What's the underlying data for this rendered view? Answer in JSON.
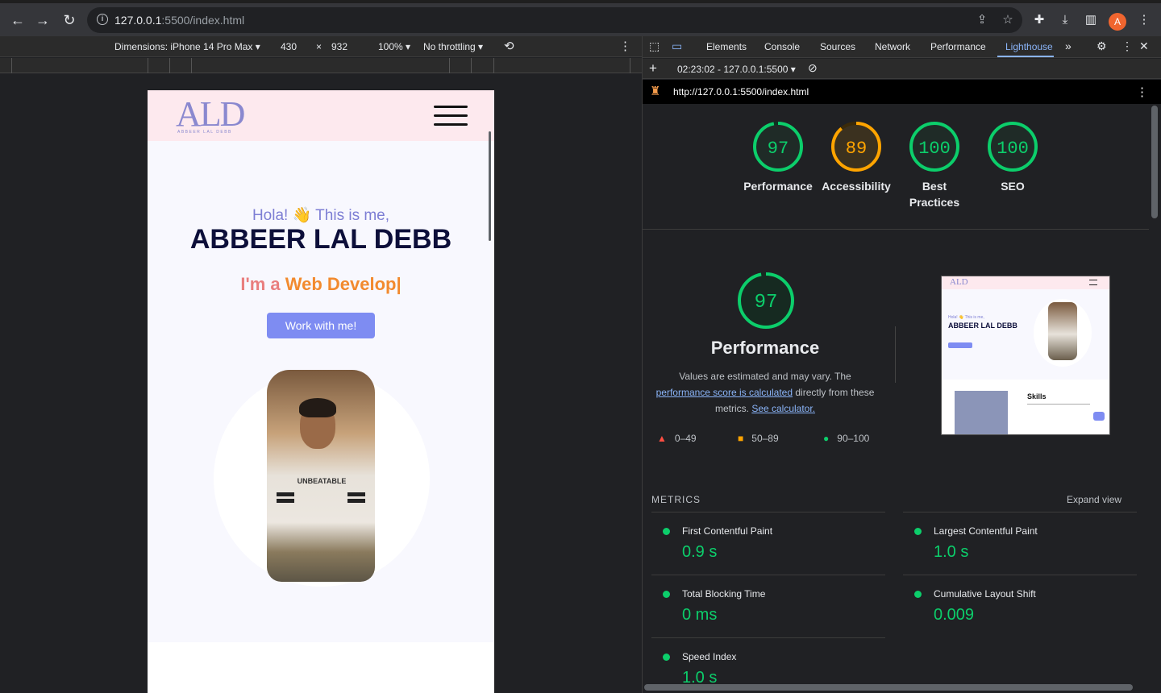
{
  "browser": {
    "url_host": "127.0.0.1",
    "url_rest": ":5500/index.html",
    "avatar_letter": "A"
  },
  "device_toolbar": {
    "dimensions": "Dimensions: iPhone 14 Pro Max",
    "width": "430",
    "x": "×",
    "height": "932",
    "zoom": "100%",
    "throttling": "No throttling"
  },
  "site": {
    "logo": "ALD",
    "logo_sub": "ABBEER LAL DEBB",
    "greeting": "Hola! 👋 This is me,",
    "name": "ABBEER LAL DEBB",
    "typed_prefix": "I'm a ",
    "typed_highlight": "Web Develop|",
    "cta": "Work with me!",
    "shirt_text": "UNBEATABLE"
  },
  "devtools": {
    "tabs": [
      "Elements",
      "Console",
      "Sources",
      "Network",
      "Performance",
      "Lighthouse"
    ],
    "active_tab": "Lighthouse",
    "report_select": "02:23:02 - 127.0.0.1:5500",
    "report_url": "http://127.0.0.1:5500/index.html"
  },
  "scores": [
    {
      "value": 97,
      "label": "Performance",
      "color": "#0cce6b"
    },
    {
      "value": 89,
      "label": "Accessibility",
      "color": "#ffa400"
    },
    {
      "value": 100,
      "label": "Best Practices",
      "color": "#0cce6b"
    },
    {
      "value": 100,
      "label": "SEO",
      "color": "#0cce6b"
    }
  ],
  "performance": {
    "score": "97",
    "title": "Performance",
    "desc_1": "Values are estimated and may vary. The",
    "desc_link_1": "performance score is calculated",
    "desc_2": "directly from these metrics.",
    "desc_link_2": "See calculator.",
    "legend": {
      "fail": "0–49",
      "average": "50–89",
      "pass": "90–100"
    }
  },
  "thumbnail": {
    "logo": "ALD",
    "hola": "Hola! 👋 This is me,",
    "name": "ABBEER LAL DEBB",
    "skills": "Skills"
  },
  "metrics": {
    "heading": "METRICS",
    "expand": "Expand view",
    "items": [
      {
        "name": "First Contentful Paint",
        "value": "0.9 s"
      },
      {
        "name": "Largest Contentful Paint",
        "value": "1.0 s"
      },
      {
        "name": "Total Blocking Time",
        "value": "0 ms"
      },
      {
        "name": "Cumulative Layout Shift",
        "value": "0.009"
      },
      {
        "name": "Speed Index",
        "value": "1.0 s"
      }
    ]
  },
  "colors": {
    "pass": "#0cce6b",
    "average": "#ffa400",
    "fail": "#ff4e42",
    "accent": "#8ab4f8"
  }
}
